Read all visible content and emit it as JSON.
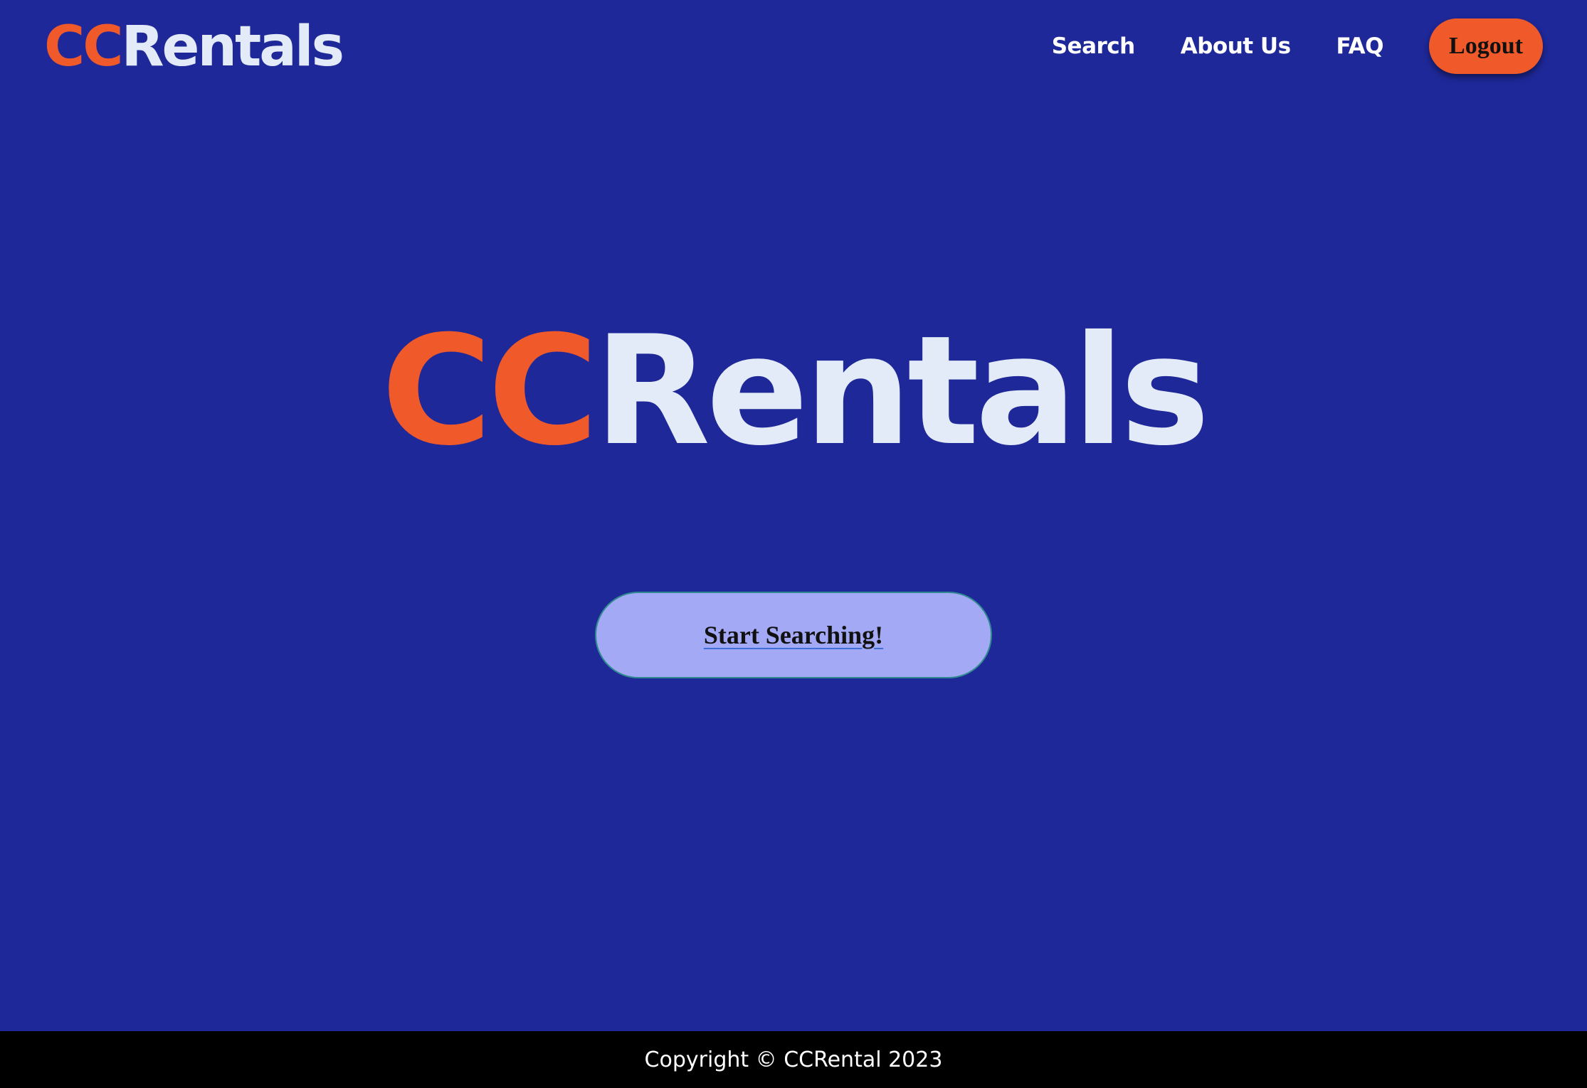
{
  "header": {
    "logo": {
      "cc": "CC",
      "rest": "Rentals"
    },
    "nav": {
      "search": "Search",
      "about": "About Us",
      "faq": "FAQ"
    },
    "logout_label": "Logout"
  },
  "hero": {
    "logo": {
      "cc": "CC",
      "rest": "Rentals"
    },
    "cta_label": "Start Searching!"
  },
  "footer": {
    "copyright": "Copyright © CCRental 2023"
  },
  "colors": {
    "background": "#1e2898",
    "brand_orange": "#f05a2a",
    "logo_light": "#e3ebf8",
    "cta_background": "#a3a9f4",
    "footer_background": "#000000"
  }
}
